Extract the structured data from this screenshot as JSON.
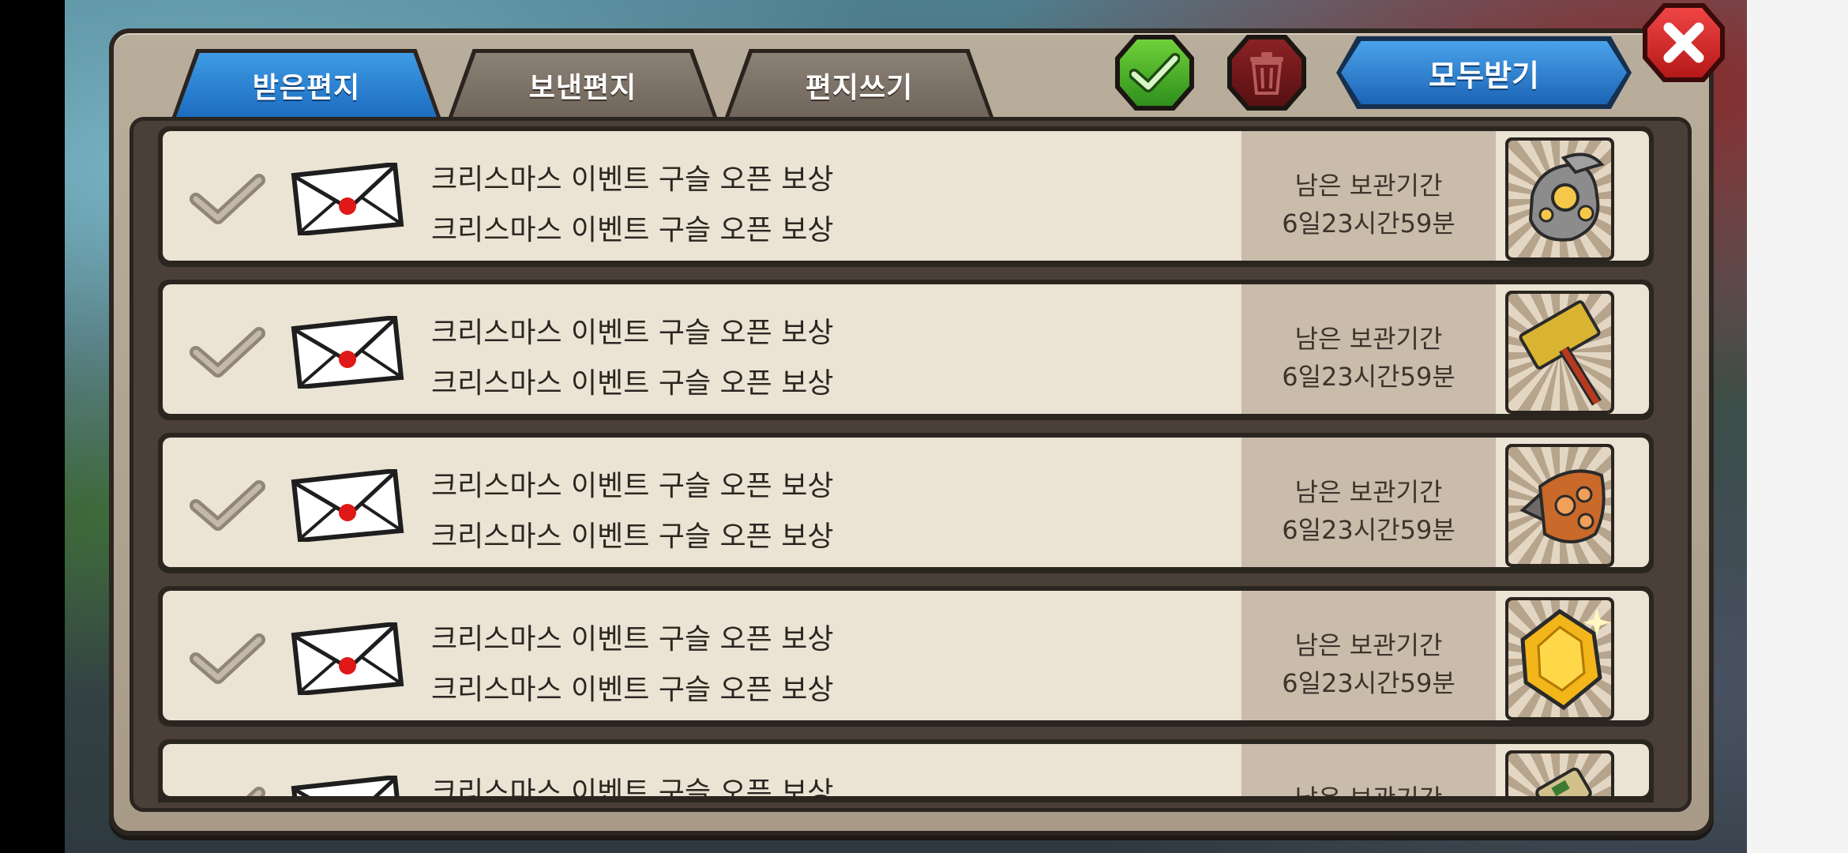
{
  "tabs": [
    {
      "label": "받은편지",
      "active": true
    },
    {
      "label": "보낸편지",
      "active": false
    },
    {
      "label": "편지쓰기",
      "active": false
    }
  ],
  "actions": {
    "receive_all_label": "모두받기",
    "select_all_icon": "green-check-icon",
    "delete_icon": "trash-icon",
    "close_icon": "close-x-icon"
  },
  "messages": [
    {
      "title": "크리스마스 이벤트 구슬 오픈 보상",
      "subtitle": "크리스마스 이벤트 구슬 오픈 보상",
      "expire_label": "남은 보관기간",
      "expire_time": "6일23시간59분",
      "item_icon": "stone-gauntlet-icon"
    },
    {
      "title": "크리스마스 이벤트 구슬 오픈 보상",
      "subtitle": "크리스마스 이벤트 구슬 오픈 보상",
      "expire_label": "남은 보관기간",
      "expire_time": "6일23시간59분",
      "item_icon": "golden-hammer-icon"
    },
    {
      "title": "크리스마스 이벤트 구슬 오픈 보상",
      "subtitle": "크리스마스 이벤트 구슬 오픈 보상",
      "expire_label": "남은 보관기간",
      "expire_time": "6일23시간59분",
      "item_icon": "bronze-gauntlet-icon"
    },
    {
      "title": "크리스마스 이벤트 구슬 오픈 보상",
      "subtitle": "크리스마스 이벤트 구슬 오픈 보상",
      "expire_label": "남은 보관기간",
      "expire_time": "6일23시간59분",
      "item_icon": "gold-gem-icon"
    },
    {
      "title": "크리스마스 이벤트 구슬 오픈 보상",
      "subtitle": "",
      "expire_label": "남은 보관기간",
      "expire_time": "",
      "item_icon": "scroll-icon"
    }
  ],
  "colors": {
    "tab_active": "#1d6cc0",
    "tab_inactive": "#7a6f64",
    "row_bg": "#ebe3d3",
    "expire_bg": "#c9bcaa",
    "close_red": "#d42525",
    "check_green": "#3fae26"
  }
}
